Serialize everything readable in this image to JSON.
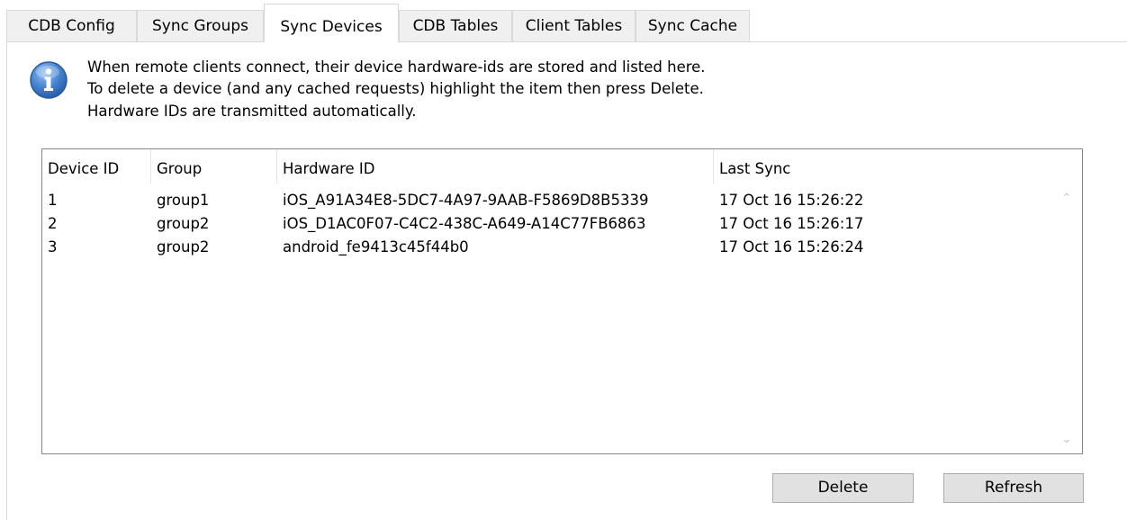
{
  "tabs": [
    {
      "label": "CDB Config",
      "active": false
    },
    {
      "label": "Sync Groups",
      "active": false
    },
    {
      "label": "Sync Devices",
      "active": true
    },
    {
      "label": "CDB Tables",
      "active": false
    },
    {
      "label": "Client Tables",
      "active": false
    },
    {
      "label": "Sync Cache",
      "active": false
    }
  ],
  "info": {
    "icon": "info-icon",
    "lines": [
      "When remote clients connect, their device hardware-ids are stored and listed here.",
      "To delete a device (and any cached requests) highlight the item then press Delete.",
      "Hardware IDs are transmitted automatically."
    ]
  },
  "device_list": {
    "columns": [
      "Device ID",
      "Group",
      "Hardware ID",
      "Last Sync"
    ],
    "rows": [
      {
        "device_id": "1",
        "group": "group1",
        "hardware_id": "iOS_A91A34E8-5DC7-4A97-9AAB-F5869D8B5339",
        "last_sync": "17 Oct 16  15:26:22"
      },
      {
        "device_id": "2",
        "group": "group2",
        "hardware_id": "iOS_D1AC0F07-C4C2-438C-A649-A14C77FB6863",
        "last_sync": "17 Oct 16  15:26:17"
      },
      {
        "device_id": "3",
        "group": "group2",
        "hardware_id": "android_fe9413c45f44b0",
        "last_sync": "17 Oct 16  15:26:24"
      }
    ]
  },
  "buttons": {
    "delete": "Delete",
    "refresh": "Refresh"
  },
  "colors": {
    "tab_inactive": "#f0f0f0",
    "border": "#d9d9d9",
    "button_face": "#e1e1e1",
    "info_blue": "#3a72c4"
  }
}
